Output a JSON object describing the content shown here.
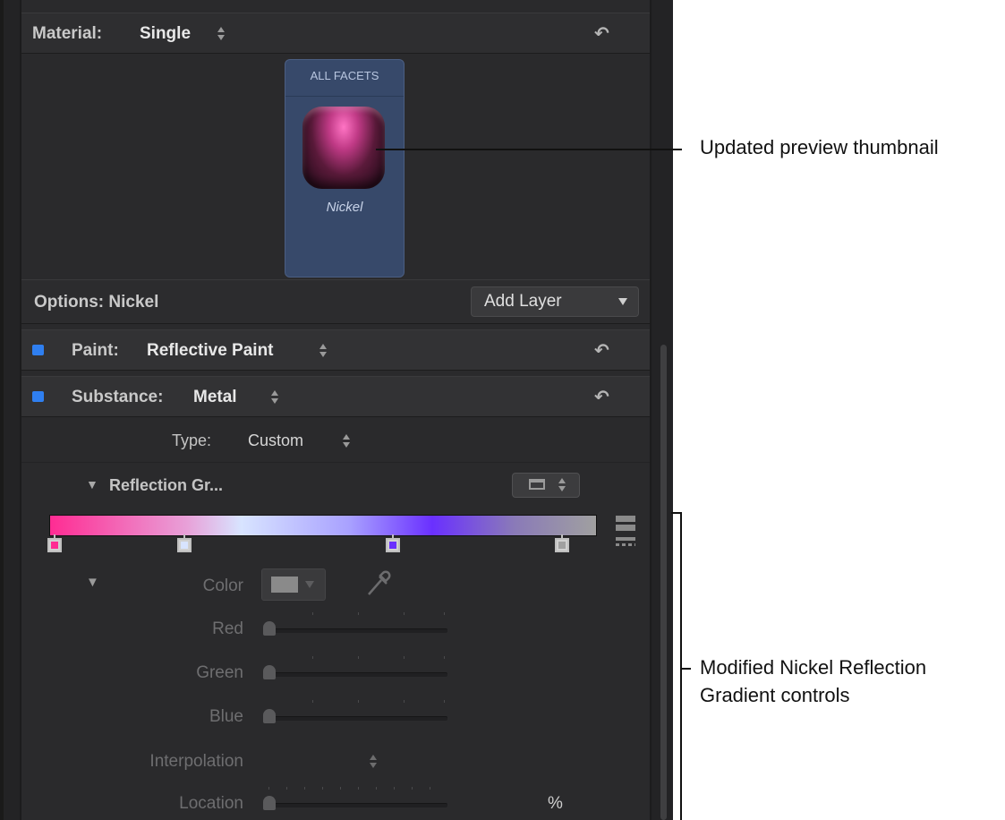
{
  "material": {
    "label": "Material:",
    "value": "Single"
  },
  "thumbnail": {
    "facets_label": "ALL FACETS",
    "name": "Nickel"
  },
  "options": {
    "label": "Options: Nickel",
    "add_layer": "Add Layer"
  },
  "paint": {
    "label": "Paint:",
    "value": "Reflective Paint"
  },
  "substance": {
    "label": "Substance:",
    "value": "Metal"
  },
  "type": {
    "label": "Type:",
    "value": "Custom"
  },
  "reflection": {
    "label": "Reflection Gr..."
  },
  "gradient": {
    "stops": [
      {
        "color": "#ff2c93"
      },
      {
        "color": "#d8e4ff"
      },
      {
        "color": "#6a30ff"
      },
      {
        "color": "#a0a0a0"
      }
    ]
  },
  "color_section": {
    "color_label": "Color",
    "red_label": "Red",
    "green_label": "Green",
    "blue_label": "Blue",
    "interpolation_label": "Interpolation",
    "location_label": "Location",
    "location_unit": "%"
  },
  "callouts": {
    "thumbnail": "Updated preview thumbnail",
    "gradient_line1": "Modified Nickel Reflection",
    "gradient_line2": "Gradient controls"
  }
}
